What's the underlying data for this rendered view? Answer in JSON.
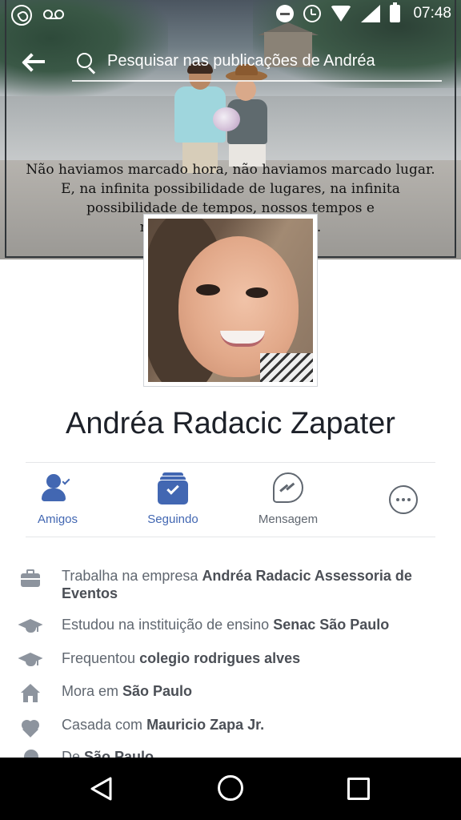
{
  "status_bar": {
    "time": "07:48",
    "left_icons": [
      "whatsapp-icon",
      "voicemail-icon"
    ],
    "right_icons": [
      "do-not-disturb-icon",
      "alarm-icon",
      "wifi-icon",
      "signal-icon",
      "battery-icon"
    ]
  },
  "header": {
    "back_icon": "back-arrow-icon",
    "search_icon": "search-icon",
    "search_placeholder": "Pesquisar nas publicações de Andréa"
  },
  "cover": {
    "quote_lines": [
      "Não haviamos marcado hora, não haviamos marcado lugar.",
      "E, na infinita possibilidade de lugares, na infinita",
      "possibilidade de tempos, nossos tempos e",
      "no                                  m."
    ]
  },
  "profile": {
    "name": "Andréa Radacic Zapater"
  },
  "actions": [
    {
      "label": "Amigos",
      "icon": "friends-icon",
      "active": true
    },
    {
      "label": "Seguindo",
      "icon": "following-icon",
      "active": true
    },
    {
      "label": "Mensagem",
      "icon": "messenger-icon",
      "active": false
    },
    {
      "label": "",
      "icon": "more-icon",
      "active": false
    }
  ],
  "about": [
    {
      "icon": "briefcase-icon",
      "prefix": "Trabalha na empresa ",
      "value": "Andréa Radacic Assessoria de Eventos"
    },
    {
      "icon": "graduation-cap-icon",
      "prefix": "Estudou na instituição de ensino ",
      "value": "Senac São Paulo"
    },
    {
      "icon": "graduation-cap-icon",
      "prefix": "Frequentou ",
      "value": "colegio rodrigues alves"
    },
    {
      "icon": "home-icon",
      "prefix": "Mora em ",
      "value": "São Paulo"
    },
    {
      "icon": "heart-icon",
      "prefix": "Casada com ",
      "value": "Mauricio Zapa Jr."
    },
    {
      "icon": "location-pin-icon",
      "prefix": "De ",
      "value": "São Paulo"
    }
  ],
  "colors": {
    "accent": "#4267b2",
    "secondary_text": "#606770",
    "name_text": "#1d2129",
    "icon_gray": "#8d949e"
  },
  "nav_bar": {
    "icons": [
      "nav-back-icon",
      "nav-home-icon",
      "nav-recents-icon"
    ]
  }
}
